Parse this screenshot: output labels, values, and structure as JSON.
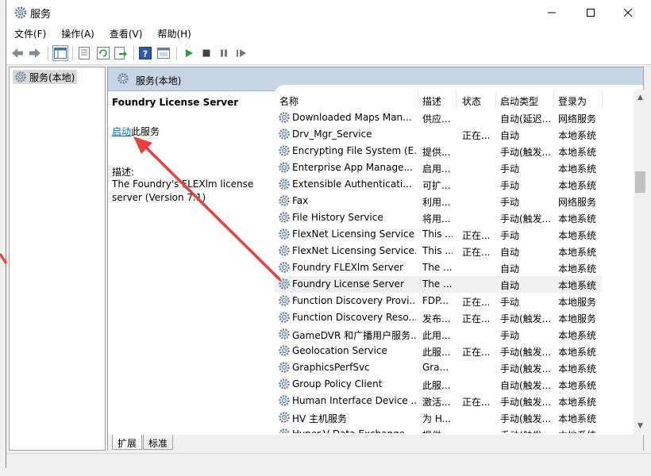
{
  "window": {
    "title": "服务"
  },
  "menu": {
    "file": "文件(F)",
    "action": "操作(A)",
    "view": "查看(V)",
    "help": "帮助(H)"
  },
  "tree": {
    "item": "服务(本地)"
  },
  "pane": {
    "header": "服务(本地)"
  },
  "detail": {
    "service_name": "Foundry License Server",
    "start_link": "启动",
    "start_suffix": "此服务",
    "desc_label": "描述:",
    "desc_text": "The Foundry's FLEXlm license server (Version 7.1)"
  },
  "columns": {
    "name": "名称",
    "desc": "描述",
    "state": "状态",
    "start_type": "启动类型",
    "logon": "登录为"
  },
  "rows": [
    {
      "name": "Downloaded Maps Man...",
      "desc": "供应...",
      "state": "",
      "start": "自动(延迟...",
      "logon": "网络服务"
    },
    {
      "name": "Drv_Mgr_Service",
      "desc": "",
      "state": "正在...",
      "start": "自动",
      "logon": "本地系统"
    },
    {
      "name": "Encrypting File System (E...",
      "desc": "提供...",
      "state": "",
      "start": "手动(触发...",
      "logon": "本地系统"
    },
    {
      "name": "Enterprise App Manage...",
      "desc": "启用...",
      "state": "",
      "start": "手动",
      "logon": "本地系统"
    },
    {
      "name": "Extensible Authenticati...",
      "desc": "可扩...",
      "state": "",
      "start": "手动",
      "logon": "本地系统"
    },
    {
      "name": "Fax",
      "desc": "利用...",
      "state": "",
      "start": "手动",
      "logon": "网络服务"
    },
    {
      "name": "File History Service",
      "desc": "将用...",
      "state": "",
      "start": "手动(触发...",
      "logon": "本地系统"
    },
    {
      "name": "FlexNet Licensing Service",
      "desc": "This ...",
      "state": "正在...",
      "start": "手动",
      "logon": "本地系统"
    },
    {
      "name": "FlexNet Licensing Service...",
      "desc": "This ...",
      "state": "正在...",
      "start": "自动",
      "logon": "本地系统"
    },
    {
      "name": "Foundry FLEXlm Server",
      "desc": "The ...",
      "state": "",
      "start": "自动",
      "logon": "本地系统"
    },
    {
      "name": "Foundry License Server",
      "desc": "The ...",
      "state": "",
      "start": "自动",
      "logon": "本地系统"
    },
    {
      "name": "Function Discovery Provi...",
      "desc": "FDP...",
      "state": "正在...",
      "start": "手动",
      "logon": "本地服务"
    },
    {
      "name": "Function Discovery Reso...",
      "desc": "发布...",
      "state": "正在...",
      "start": "手动(触发...",
      "logon": "本地服务"
    },
    {
      "name": "GameDVR 和广播用户服务...",
      "desc": "此用...",
      "state": "",
      "start": "手动",
      "logon": "本地系统"
    },
    {
      "name": "Geolocation Service",
      "desc": "此服...",
      "state": "正在...",
      "start": "手动(触发...",
      "logon": "本地系统"
    },
    {
      "name": "GraphicsPerfSvc",
      "desc": "Gra...",
      "state": "",
      "start": "手动(触发...",
      "logon": "本地系统"
    },
    {
      "name": "Group Policy Client",
      "desc": "此服...",
      "state": "",
      "start": "自动(触发...",
      "logon": "本地系统"
    },
    {
      "name": "Human Interface Device ...",
      "desc": "激活...",
      "state": "正在...",
      "start": "手动(触发...",
      "logon": "本地系统"
    },
    {
      "name": "HV 主机服务",
      "desc": "为 H...",
      "state": "",
      "start": "手动(触发...",
      "logon": "本地系统"
    },
    {
      "name": "Hyper-V Data Exchange ...",
      "desc": "提供...",
      "state": "",
      "start": "手动(触发...",
      "logon": "本地系统"
    }
  ],
  "tabs": {
    "extended": "扩展",
    "standard": "标准"
  },
  "icons": [
    "gear-icon",
    "back-arrow-icon",
    "forward-arrow-icon",
    "play-icon",
    "stop-icon",
    "pause-icon",
    "restart-icon",
    "help-icon"
  ]
}
